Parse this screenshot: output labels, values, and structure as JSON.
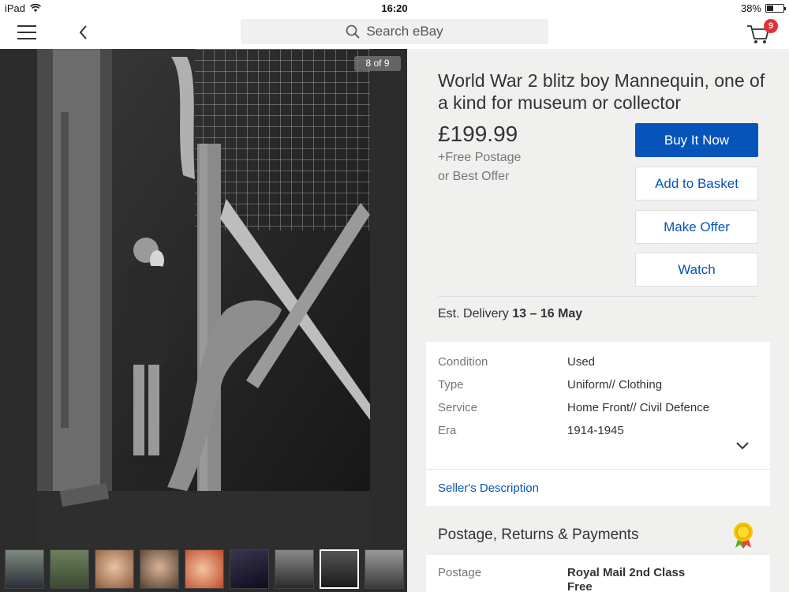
{
  "status_bar": {
    "device": "iPad",
    "time": "16:20",
    "battery": "38%",
    "battery_level": 0.38
  },
  "nav": {
    "search_placeholder": "Search eBay",
    "cart_count": "9"
  },
  "gallery": {
    "counter": "8 of 9",
    "thumbnail_count": 9,
    "selected_index": 7
  },
  "listing": {
    "title": "World War 2  blitz boy Mannequin, one of a kind for museum or collector",
    "price": "£199.99",
    "postage": "+Free Postage",
    "best_offer": "or Best Offer",
    "buttons": {
      "buy_now": "Buy It Now",
      "add_to_basket": "Add to Basket",
      "make_offer": "Make Offer",
      "watch": "Watch"
    },
    "delivery_label": "Est. Delivery",
    "delivery_dates": "13 – 16 May"
  },
  "specifics": [
    {
      "key": "Condition",
      "value": "Used"
    },
    {
      "key": "Type",
      "value": "Uniform// Clothing"
    },
    {
      "key": "Service",
      "value": "Home Front// Civil Defence"
    },
    {
      "key": "Era",
      "value": "1914-1945"
    }
  ],
  "seller_description_link": "Seller's Description",
  "prp": {
    "title": "Postage, Returns & Payments",
    "postage_label": "Postage",
    "postage_service": "Royal Mail 2nd Class",
    "postage_cost": "Free"
  },
  "colors": {
    "accent_blue": "#0654ba",
    "badge_red": "#e43137",
    "page_bg": "#f0f0ef"
  }
}
